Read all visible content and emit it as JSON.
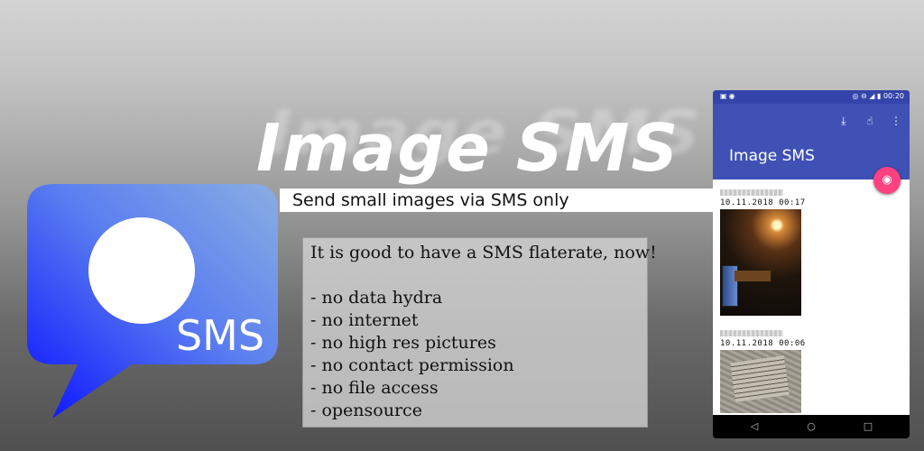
{
  "banner": {
    "title": "Image SMS",
    "subtitle": "Send small images via SMS only"
  },
  "logo": {
    "text": "SMS",
    "icon": "speech-bubble-icon",
    "colors": {
      "bubble_light": "#7fa3e0",
      "bubble_dark": "#0a14ff",
      "circle": "#ffffff"
    }
  },
  "features": {
    "lines": [
      "It is good to have a SMS flaterate, now!",
      "",
      "- no data hydra",
      "- no internet",
      "- no high res pictures",
      "- no contact permission",
      "- no file access",
      "- opensource"
    ]
  },
  "phone": {
    "status_bar": {
      "left_icons": [
        "image-icon",
        "record-icon"
      ],
      "right_icons": [
        "hotspot-icon",
        "dnd-icon",
        "signal-icon",
        "battery-icon"
      ],
      "time": "00:20"
    },
    "app_bar": {
      "title": "Image SMS",
      "actions": [
        "download-icon",
        "share-icon",
        "more-vert-icon"
      ],
      "colors": {
        "primary": "#3f51b5",
        "status": "#3444aa"
      }
    },
    "fab": {
      "icon": "camera-icon",
      "color": "#ff4081"
    },
    "messages": [
      {
        "time": "10.11.2018  00:17",
        "image": "photo-lamp-room"
      },
      {
        "time": "10.11.2018  00:06",
        "image": "photo-paper-note"
      }
    ],
    "nav_bar": [
      "back-icon",
      "home-icon",
      "recents-icon"
    ]
  }
}
